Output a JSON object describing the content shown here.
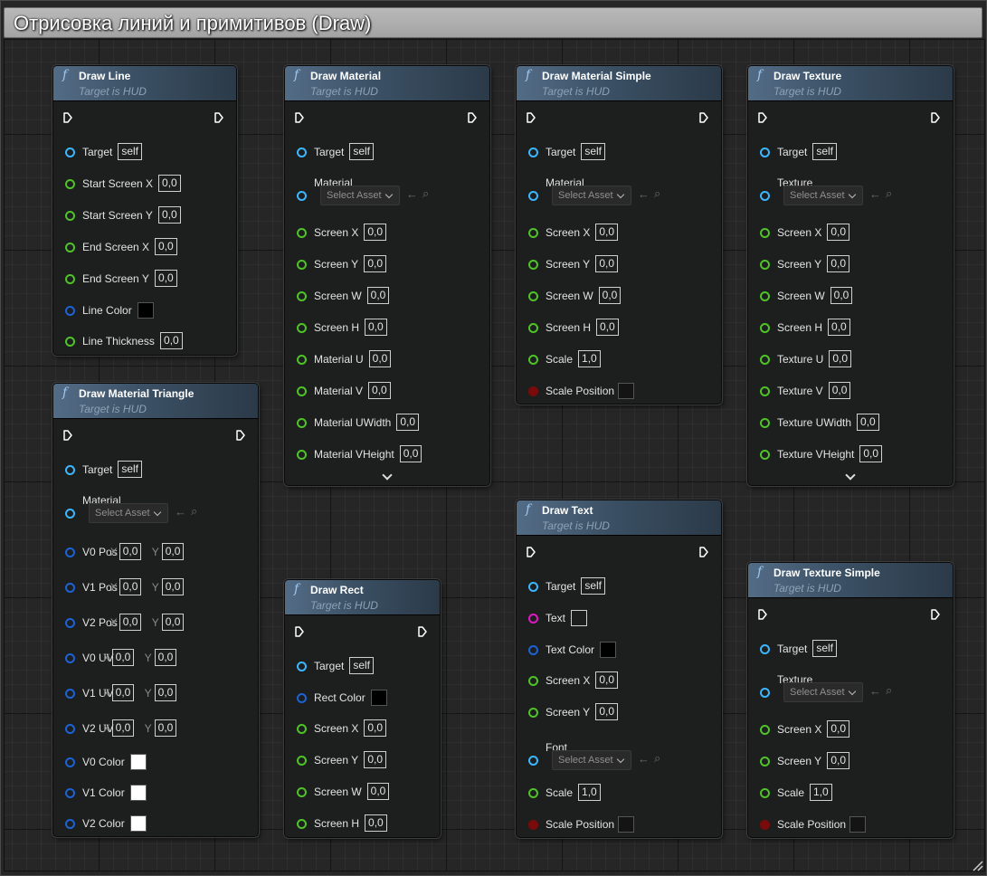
{
  "title": "Отрисовка линий и примитивов (Draw)",
  "fn_icon": "f",
  "dropdown_label": "Select Asset",
  "colors": {
    "black": "#000000",
    "white": "#ffffff",
    "dark": "#141414"
  },
  "nodes": [
    {
      "title": "Draw Line",
      "subtitle": "Target is HUD",
      "pins": [
        {
          "label": "Target",
          "value": "self"
        },
        {
          "label": "Start Screen X",
          "value": "0,0"
        },
        {
          "label": "Start Screen Y",
          "value": "0,0"
        },
        {
          "label": "End Screen X",
          "value": "0,0"
        },
        {
          "label": "End Screen Y",
          "value": "0,0"
        },
        {
          "label": "Line Color",
          "swatch": "black"
        },
        {
          "label": "Line Thickness",
          "value": "0,0"
        }
      ]
    },
    {
      "title": "Draw Material Triangle",
      "subtitle": "Target is HUD",
      "pins": [
        {
          "label": "Target",
          "value": "self"
        },
        {
          "label": "Material",
          "asset": "Select Asset"
        },
        {
          "label": "V0 Pos",
          "x": "0,0",
          "y": "0,0"
        },
        {
          "label": "V1 Pos",
          "x": "0,0",
          "y": "0,0"
        },
        {
          "label": "V2 Pos",
          "x": "0,0",
          "y": "0,0"
        },
        {
          "label": "V0 UV",
          "x": "0,0",
          "y": "0,0"
        },
        {
          "label": "V1 UV",
          "x": "0,0",
          "y": "0,0"
        },
        {
          "label": "V2 UV",
          "x": "0,0",
          "y": "0,0"
        },
        {
          "label": "V0 Color",
          "swatch": "white"
        },
        {
          "label": "V1 Color",
          "swatch": "white"
        },
        {
          "label": "V2 Color",
          "swatch": "white"
        }
      ]
    },
    {
      "title": "Draw Material",
      "subtitle": "Target is HUD",
      "pins": [
        {
          "label": "Target",
          "value": "self"
        },
        {
          "label": "Material",
          "asset": "Select Asset"
        },
        {
          "label": "Screen X",
          "value": "0,0"
        },
        {
          "label": "Screen Y",
          "value": "0,0"
        },
        {
          "label": "Screen W",
          "value": "0,0"
        },
        {
          "label": "Screen H",
          "value": "0,0"
        },
        {
          "label": "Material U",
          "value": "0,0"
        },
        {
          "label": "Material V",
          "value": "0,0"
        },
        {
          "label": "Material UWidth",
          "value": "0,0"
        },
        {
          "label": "Material VHeight",
          "value": "0,0"
        }
      ]
    },
    {
      "title": "Draw Rect",
      "subtitle": "Target is HUD",
      "pins": [
        {
          "label": "Target",
          "value": "self"
        },
        {
          "label": "Rect Color",
          "swatch": "black"
        },
        {
          "label": "Screen X",
          "value": "0,0"
        },
        {
          "label": "Screen Y",
          "value": "0,0"
        },
        {
          "label": "Screen W",
          "value": "0,0"
        },
        {
          "label": "Screen H",
          "value": "0,0"
        }
      ]
    },
    {
      "title": "Draw Material Simple",
      "subtitle": "Target is HUD",
      "pins": [
        {
          "label": "Target",
          "value": "self"
        },
        {
          "label": "Material",
          "asset": "Select Asset"
        },
        {
          "label": "Screen X",
          "value": "0,0"
        },
        {
          "label": "Screen Y",
          "value": "0,0"
        },
        {
          "label": "Screen W",
          "value": "0,0"
        },
        {
          "label": "Screen H",
          "value": "0,0"
        },
        {
          "label": "Scale",
          "value": "1,0"
        },
        {
          "label": "Scale Position",
          "checkbox": "unchecked"
        }
      ]
    },
    {
      "title": "Draw Text",
      "subtitle": "Target is HUD",
      "pins": [
        {
          "label": "Target",
          "value": "self"
        },
        {
          "label": "Text",
          "textbox": ""
        },
        {
          "label": "Text Color",
          "swatch": "black"
        },
        {
          "label": "Screen X",
          "value": "0,0"
        },
        {
          "label": "Screen Y",
          "value": "0,0"
        },
        {
          "label": "Font",
          "asset": "Select Asset"
        },
        {
          "label": "Scale",
          "value": "1,0"
        },
        {
          "label": "Scale Position",
          "checkbox": "unchecked"
        }
      ]
    },
    {
      "title": "Draw Texture",
      "subtitle": "Target is HUD",
      "pins": [
        {
          "label": "Target",
          "value": "self"
        },
        {
          "label": "Texture",
          "asset": "Select Asset"
        },
        {
          "label": "Screen X",
          "value": "0,0"
        },
        {
          "label": "Screen Y",
          "value": "0,0"
        },
        {
          "label": "Screen W",
          "value": "0,0"
        },
        {
          "label": "Screen H",
          "value": "0,0"
        },
        {
          "label": "Texture U",
          "value": "0,0"
        },
        {
          "label": "Texture V",
          "value": "0,0"
        },
        {
          "label": "Texture UWidth",
          "value": "0,0"
        },
        {
          "label": "Texture VHeight",
          "value": "0,0"
        }
      ]
    },
    {
      "title": "Draw Texture Simple",
      "subtitle": "Target is HUD",
      "pins": [
        {
          "label": "Target",
          "value": "self"
        },
        {
          "label": "Texture",
          "asset": "Select Asset"
        },
        {
          "label": "Screen X",
          "value": "0,0"
        },
        {
          "label": "Screen Y",
          "value": "0,0"
        },
        {
          "label": "Scale",
          "value": "1,0"
        },
        {
          "label": "Scale Position",
          "checkbox": "unchecked"
        }
      ]
    }
  ]
}
